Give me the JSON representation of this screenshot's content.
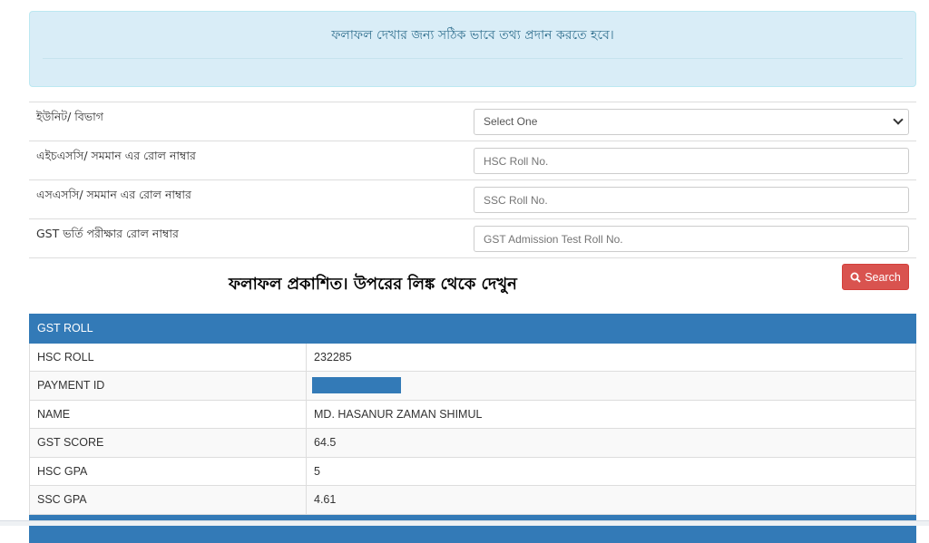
{
  "alert": {
    "message": "ফলাফল দেখার জন্য সঠিক ভাবে তথ্য প্রদান করতে হবে।"
  },
  "form": {
    "rows": [
      {
        "label": "ইউনিট/ বিভাগ",
        "type": "select",
        "value": "Select One"
      },
      {
        "label": "এইচএসসি/ সমমান এর রোল নাম্বার",
        "type": "input",
        "placeholder": "HSC Roll No."
      },
      {
        "label": "এসএসসি/ সমমান এর রোল নাম্বার",
        "type": "input",
        "placeholder": "SSC Roll No."
      },
      {
        "label": "GST ভর্তি পরীক্ষার রোল নাম্বার",
        "type": "input",
        "placeholder": "GST Admission Test Roll No."
      }
    ]
  },
  "notice": "ফলাফল প্রকাশিত। উপরের লিঙ্ক থেকে দেখুন",
  "search_button": {
    "label": "Search",
    "icon": "search-icon",
    "color": "#d9534f"
  },
  "result": {
    "header_color": "#337ab7",
    "rows": [
      {
        "label": "GST ROLL",
        "value": ""
      },
      {
        "label": "HSC ROLL",
        "value": "232285"
      },
      {
        "label": "PAYMENT ID",
        "value": ""
      },
      {
        "label": "NAME",
        "value": "MD. HASANUR ZAMAN SHIMUL"
      },
      {
        "label": "GST SCORE",
        "value": "64.5"
      },
      {
        "label": "HSC GPA",
        "value": "5"
      },
      {
        "label": "SSC GPA",
        "value": "4.61"
      }
    ]
  }
}
